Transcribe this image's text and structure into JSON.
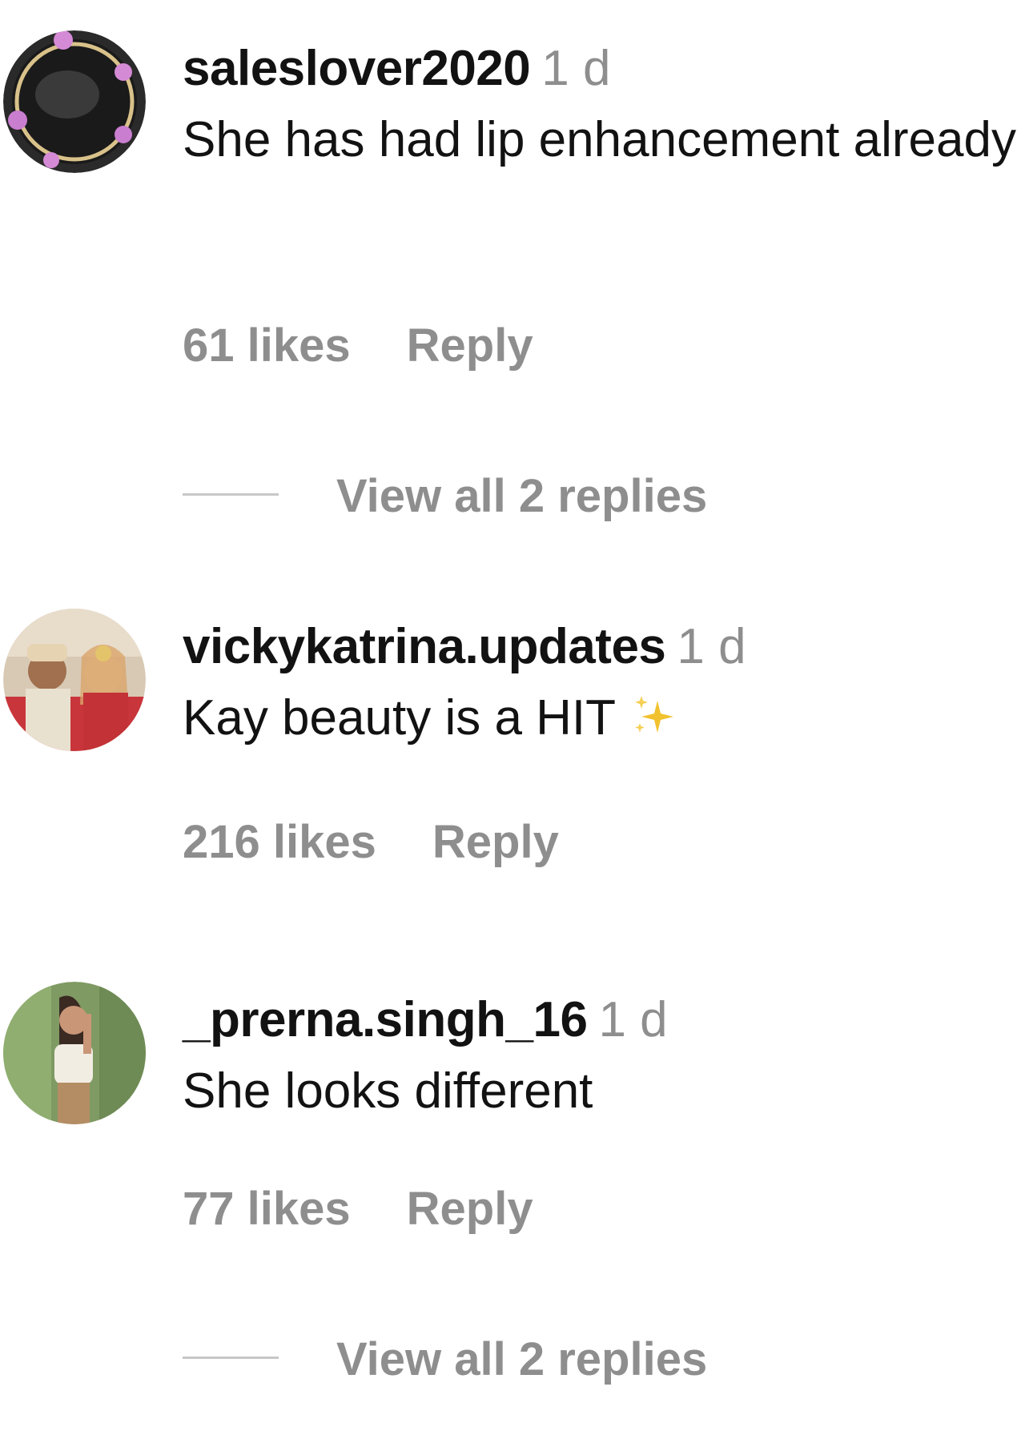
{
  "comments": [
    {
      "username": "saleslover2020",
      "time": "1 d",
      "text": "She has had lip enhancement already",
      "likes": "61 likes",
      "reply_label": "Reply",
      "view_replies": "View all 2 replies",
      "avatar_icon": "avatar-dark-floral-frame"
    },
    {
      "username": "vickykatrina.updates",
      "time": "1 d",
      "text": "Kay beauty is a HIT",
      "emoji": "sparkles-icon",
      "likes": "216 likes",
      "reply_label": "Reply",
      "avatar_icon": "avatar-couple-photo"
    },
    {
      "username": "_prerna.singh_16",
      "time": "1 d",
      "text": "She looks different",
      "likes": "77 likes",
      "reply_label": "Reply",
      "view_replies": "View all 2 replies",
      "avatar_icon": "avatar-woman-green-background"
    }
  ],
  "colors": {
    "text": "#121212",
    "muted": "#8e8e8e",
    "divider": "#c7c7c7",
    "sparkle": "#f2c12e"
  }
}
